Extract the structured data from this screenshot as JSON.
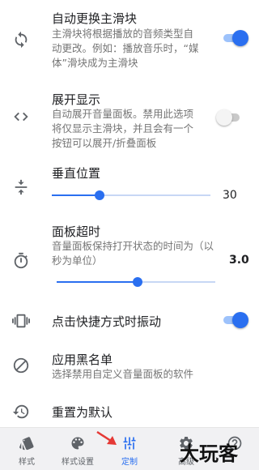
{
  "settings": {
    "auto_switch": {
      "title": "自动更换主滑块",
      "desc": [
        "主滑块将根据播放的音频类型自",
        "动更改。例如：播放音乐时，“媒",
        "体”滑块成为主滑块"
      ],
      "enabled": true,
      "icon": "sync-icon"
    },
    "expand": {
      "title": "展开显示",
      "desc": [
        "自动展开音量面板。禁用此选项",
        "将仅显示主滑块，并且会有一个",
        "按钮可以展开/折叠面板"
      ],
      "enabled": false,
      "icon": "expand-code-icon"
    },
    "vertical": {
      "title": "垂直位置",
      "value": "30",
      "fraction": 0.3,
      "icon": "vertical-align-center-icon"
    },
    "timeout": {
      "title": "面板超时",
      "desc": [
        "音量面板保持打开状态的时间为（以",
        "秒为单位）"
      ],
      "value": "3.0",
      "fraction": 0.51,
      "icon": "timer-icon"
    },
    "vibrate": {
      "title": "点击快捷方式时振动",
      "enabled": true,
      "icon": "vibration-icon"
    },
    "blacklist": {
      "title": "应用黑名单",
      "desc": [
        "选择禁用自定义音量面板的软件"
      ],
      "icon": "block-icon"
    },
    "reset": {
      "title": "重置为默认",
      "icon": "restore-icon"
    }
  },
  "nav": [
    {
      "label": "样式",
      "icon": "style-icon",
      "active": false
    },
    {
      "label": "样式设置",
      "icon": "palette-icon",
      "active": false
    },
    {
      "label": "定制",
      "icon": "tune-icon",
      "active": true
    },
    {
      "label": "高级",
      "icon": "settings-icon",
      "active": false
    },
    {
      "label": "",
      "icon": "help-icon",
      "active": false
    }
  ],
  "watermark": "大玩客",
  "colors": {
    "accent": "#2a6ff0",
    "annotation_arrow": "#e53935"
  }
}
